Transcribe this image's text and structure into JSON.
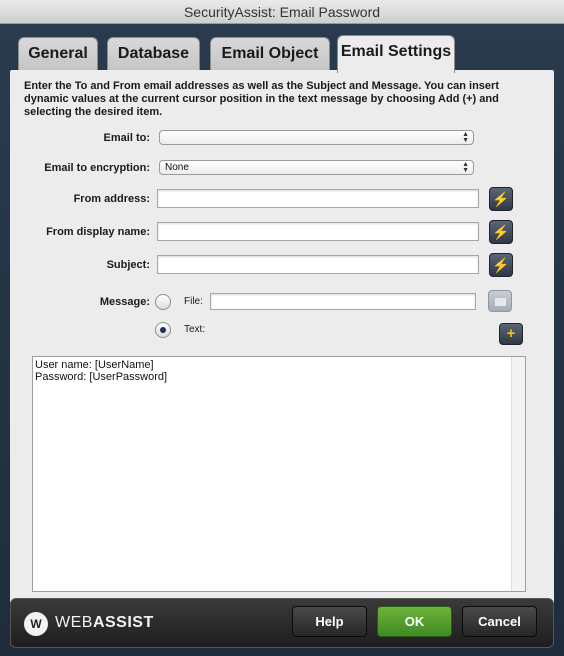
{
  "window": {
    "title": "SecurityAssist: Email Password"
  },
  "tabs": [
    "General",
    "Database",
    "Email Object",
    "Email Settings"
  ],
  "intro": "Enter the To and From email addresses as well as the Subject and Message. You can insert dynamic values at the current cursor position in the text message by choosing Add (+) and selecting the desired item.",
  "form": {
    "email_to_label": "Email to:",
    "email_to_value": "",
    "encryption_label": "Email to encryption:",
    "encryption_value": "None",
    "from_address_label": "From address:",
    "from_address_value": "",
    "from_display_label": "From display name:",
    "from_display_value": "",
    "subject_label": "Subject:",
    "subject_value": "",
    "message_label": "Message:",
    "file_label": "File:",
    "file_value": "",
    "text_label": "Text:",
    "selected_source": "Text"
  },
  "message_lines": [
    "User name: [UserName]",
    "Password: [UserPassword]"
  ],
  "footer": {
    "logo_prefix": "WEB",
    "logo_suffix": "ASSIST",
    "help": "Help",
    "ok": "OK",
    "cancel": "Cancel"
  },
  "colors": {
    "ok_button": "#4e9c2c",
    "bolt": "#f5d40f"
  },
  "icons": {
    "action": "lightning-bolt",
    "browse": "folder",
    "add": "plus"
  }
}
